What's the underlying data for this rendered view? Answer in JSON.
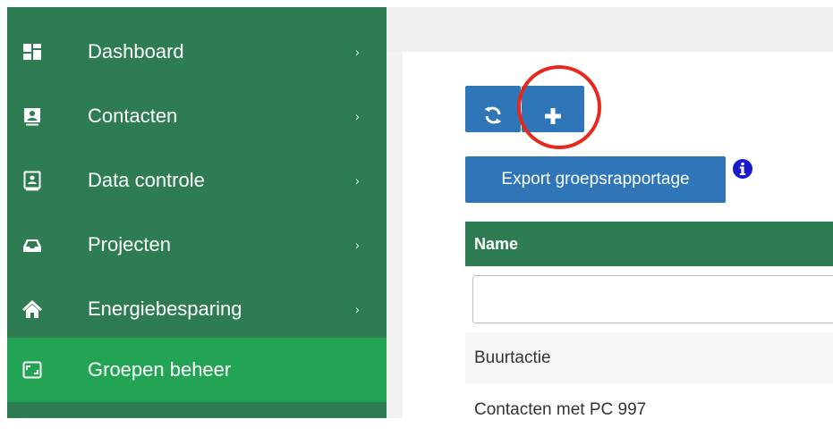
{
  "sidebar": {
    "items": [
      {
        "label": "Dashboard",
        "icon": "dashboard-icon",
        "chevron": "›",
        "active": false
      },
      {
        "label": "Contacten",
        "icon": "contact-card-icon",
        "chevron": "›",
        "active": false
      },
      {
        "label": "Data controle",
        "icon": "data-check-icon",
        "chevron": "›",
        "active": false
      },
      {
        "label": "Projecten",
        "icon": "inbox-tray-icon",
        "chevron": "›",
        "active": false
      },
      {
        "label": "Energiebesparing",
        "icon": "home-icon",
        "chevron": "›",
        "active": false
      },
      {
        "label": "Groepen beheer",
        "icon": "expand-square-icon",
        "chevron": "",
        "active": true
      }
    ]
  },
  "toolbar": {
    "refresh_icon": "refresh-icon",
    "add_icon": "plus-icon",
    "export_label": "Export groepsrapportage",
    "info_icon": "info-icon"
  },
  "table": {
    "header": "Name",
    "filter_value": "",
    "rows": [
      "Buurtactie",
      "Contacten met PC 997"
    ]
  },
  "colors": {
    "sidebar_bg": "#2e7c52",
    "sidebar_active": "#23a454",
    "button_blue": "#2f76b8",
    "highlight_red": "#e8281c"
  }
}
